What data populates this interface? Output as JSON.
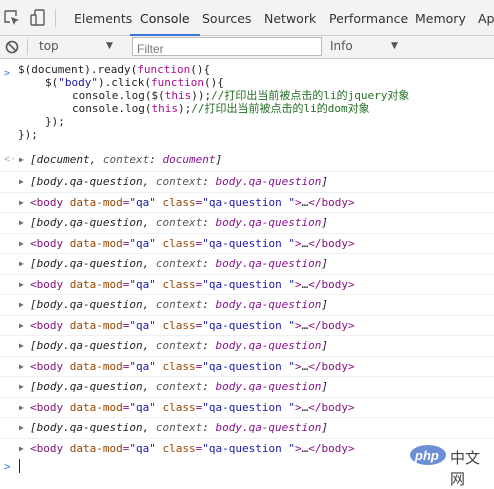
{
  "devtools": {
    "tabs": [
      {
        "label": "Elements"
      },
      {
        "label": "Console",
        "active": true
      },
      {
        "label": "Sources"
      },
      {
        "label": "Network"
      },
      {
        "label": "Performance"
      },
      {
        "label": "Memory"
      },
      {
        "label": "Ap"
      }
    ],
    "icons": {
      "inspect": "inspect-element-icon",
      "device": "device-toolbar-icon",
      "clear": "clear-console-icon"
    }
  },
  "toolbar": {
    "context_select": "top",
    "filter_placeholder": "Filter",
    "level_select": "Info"
  },
  "console": {
    "code_lines": [
      [
        "$(document).ready(",
        "function",
        "(){"
      ],
      [
        "$(",
        "\"body\"",
        ").click(",
        "function",
        "(){"
      ],
      [
        "console.log($(",
        "this",
        "));",
        "//打印出当前被点击的li的jquery对象"
      ],
      [
        "console.log(",
        "this",
        ");",
        "//打印出当前被点击的li的dom对象"
      ],
      [
        "});"
      ],
      [
        "});"
      ]
    ],
    "result_line": {
      "a": "document",
      "key": "context",
      "val": "document"
    },
    "entries": [
      {
        "kind": "jq",
        "a": "body.qa-question",
        "key": "context",
        "val": "body.qa-question"
      },
      {
        "kind": "dom",
        "tag": "body",
        "attr1": "data-mod",
        "val1": "qa",
        "attr2": "class",
        "val2": "qa-question",
        "ell": "…",
        "close": "</body>"
      },
      {
        "kind": "jq",
        "a": "body.qa-question",
        "key": "context",
        "val": "body.qa-question"
      },
      {
        "kind": "dom",
        "tag": "body",
        "attr1": "data-mod",
        "val1": "qa",
        "attr2": "class",
        "val2": "qa-question",
        "ell": "…",
        "close": "</body>"
      },
      {
        "kind": "jq",
        "a": "body.qa-question",
        "key": "context",
        "val": "body.qa-question"
      },
      {
        "kind": "dom",
        "tag": "body",
        "attr1": "data-mod",
        "val1": "qa",
        "attr2": "class",
        "val2": "qa-question",
        "ell": "…",
        "close": "</body>"
      },
      {
        "kind": "jq",
        "a": "body.qa-question",
        "key": "context",
        "val": "body.qa-question"
      },
      {
        "kind": "dom",
        "tag": "body",
        "attr1": "data-mod",
        "val1": "qa",
        "attr2": "class",
        "val2": "qa-question",
        "ell": "…",
        "close": "</body>"
      },
      {
        "kind": "jq",
        "a": "body.qa-question",
        "key": "context",
        "val": "body.qa-question"
      },
      {
        "kind": "dom",
        "tag": "body",
        "attr1": "data-mod",
        "val1": "qa",
        "attr2": "class",
        "val2": "qa-question",
        "ell": "…",
        "close": "</body>"
      },
      {
        "kind": "jq",
        "a": "body.qa-question",
        "key": "context",
        "val": "body.qa-question"
      },
      {
        "kind": "dom",
        "tag": "body",
        "attr1": "data-mod",
        "val1": "qa",
        "attr2": "class",
        "val2": "qa-question",
        "ell": "…",
        "close": "</body>"
      },
      {
        "kind": "jq",
        "a": "body.qa-question",
        "key": "context",
        "val": "body.qa-question"
      },
      {
        "kind": "dom",
        "tag": "body",
        "attr1": "data-mod",
        "val1": "qa",
        "attr2": "class",
        "val2": "qa-question",
        "ell": "…",
        "close": "</body>"
      }
    ]
  },
  "watermark": {
    "brand": "php",
    "text": "中文网"
  }
}
